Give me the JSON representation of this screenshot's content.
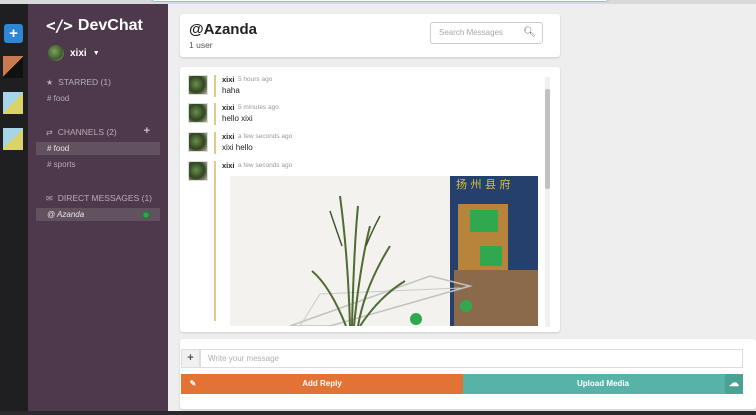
{
  "app": {
    "brand": "DevChat",
    "brand_glyph": "</>"
  },
  "rail": {
    "add_label": "+"
  },
  "sidebar": {
    "user_name": "xixi",
    "starred": {
      "title": "STARRED (1)",
      "items": [
        "# food"
      ]
    },
    "channels": {
      "title": "CHANNELS (2)",
      "add": "+",
      "items": [
        "# food",
        "# sports"
      ]
    },
    "direct": {
      "title": "DIRECT MESSAGES (1)",
      "items": [
        "@ Azanda"
      ]
    }
  },
  "header": {
    "title": "@Azanda",
    "subtitle": "1 user",
    "search_placeholder": "Search Messages"
  },
  "messages": [
    {
      "author": "xixi",
      "time": "5 hours ago",
      "text": "haha"
    },
    {
      "author": "xixi",
      "time": "5 minutes ago",
      "text": "hello xixi"
    },
    {
      "author": "xixi",
      "time": "a few seconds ago",
      "text": "xixi hello"
    },
    {
      "author": "xixi",
      "time": "a few seconds ago",
      "text": ""
    }
  ],
  "image_sign_text": "扬 州 县 府",
  "composer": {
    "plus": "+",
    "placeholder": "Write your message",
    "reply_label": "Add Reply",
    "upload_label": "Upload Media"
  },
  "colors": {
    "sidebar_bg": "#4d394b",
    "reply": "#e27335",
    "upload": "#57b3a8",
    "online": "#2fa84f"
  }
}
